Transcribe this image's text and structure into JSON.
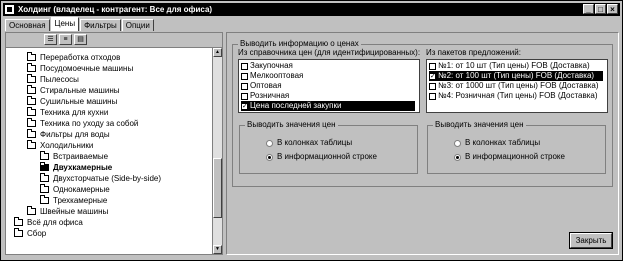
{
  "window": {
    "title": "Холдинг  (владелец - контрагент:  Все для офиса)",
    "controls": [
      "_",
      "□",
      "×"
    ]
  },
  "tabs": [
    "Основная",
    "Цены",
    "Фильтры",
    "Опции"
  ],
  "active_tab": "Цены",
  "tree": {
    "items": [
      {
        "label": "Переработка отходов",
        "depth": 1
      },
      {
        "label": "Посудомоечные машины",
        "depth": 1
      },
      {
        "label": "Пылесосы",
        "depth": 1
      },
      {
        "label": "Стиральные машины",
        "depth": 1
      },
      {
        "label": "Сушильные машины",
        "depth": 1
      },
      {
        "label": "Техника для кухни",
        "depth": 1
      },
      {
        "label": "Техника по уходу за собой",
        "depth": 1
      },
      {
        "label": "Фильтры для воды",
        "depth": 1
      },
      {
        "label": "Холодильники",
        "depth": 1
      },
      {
        "label": "Встраиваемые",
        "depth": 2
      },
      {
        "label": "Двухкамерные",
        "depth": 2,
        "selected": true
      },
      {
        "label": "Двухсторчатые (Side-by-side)",
        "depth": 2
      },
      {
        "label": "Однокамерные",
        "depth": 2
      },
      {
        "label": "Трехкамерные",
        "depth": 2
      },
      {
        "label": "Швейные машины",
        "depth": 1
      },
      {
        "label": "Всё для офиса",
        "depth": 0
      },
      {
        "label": "Сбор",
        "depth": 0
      }
    ]
  },
  "price_info": {
    "group_label": "Выводить информацию о ценах",
    "directory_label": "Из справочника цен (для идентифицированных):",
    "directory_items": [
      {
        "label": "Закупочная",
        "checked": false
      },
      {
        "label": "Мелкооптовая",
        "checked": false
      },
      {
        "label": "Оптовая",
        "checked": false
      },
      {
        "label": "Розничная",
        "checked": false
      },
      {
        "label": "Цена последней закупки",
        "checked": true,
        "selected": true
      }
    ],
    "packages_label": "Из пакетов предложений:",
    "package_items": [
      {
        "label": "№1: от 10 шт (Тип цены) FOB (Доставка)",
        "checked": false
      },
      {
        "label": "№2: от 100 шт (Тип цены) FOB (Доставка)",
        "checked": true,
        "selected": true
      },
      {
        "label": "№3: от 1000 шт (Тип цены) FOB (Доставка)",
        "checked": false
      },
      {
        "label": "№4: Розничная (Тип цены) FOB (Доставка)",
        "checked": false
      }
    ],
    "left_display": {
      "label": "Выводить значения цен",
      "options": [
        {
          "label": "В колонках таблицы",
          "selected": false
        },
        {
          "label": "В информационной строке",
          "selected": true
        }
      ]
    },
    "right_display": {
      "label": "Выводить значения цен",
      "options": [
        {
          "label": "В колонках таблицы",
          "selected": false
        },
        {
          "label": "В информационной строке",
          "selected": true
        }
      ]
    }
  },
  "close_button": "Закрыть"
}
